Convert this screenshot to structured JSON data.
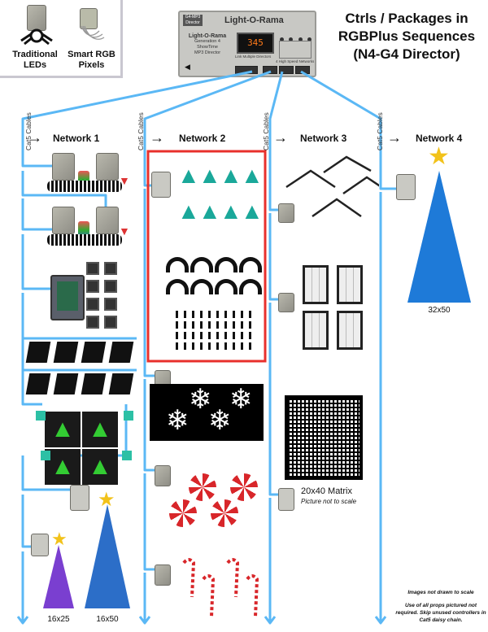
{
  "title": {
    "line1": "Ctrls / Packages in",
    "line2": "RGBPlus Sequences",
    "line3": "(N4-G4 Director)"
  },
  "legend": {
    "items": [
      {
        "label_line1": "Traditional",
        "label_line2": "LEDs",
        "icon": "traditional-controller-icon"
      },
      {
        "label_line1": "Smart RGB",
        "label_line2": "Pixels",
        "icon": "pixel-controller-icon"
      }
    ]
  },
  "director": {
    "badge_line1": "G4-MP3",
    "badge_line2": "Director",
    "brand": "Light-O-Rama",
    "model_line1": "Light-O-Rama",
    "model_line2": "Generation 4",
    "model_line3": "ShowTime",
    "model_line4": "MP3 Director",
    "display_value": "345",
    "link_label": "Link Multiple Directors",
    "networks_label": "4 High Speed Networks"
  },
  "cable_label": "Cat5 Cables",
  "networks": [
    {
      "name": "Network 1",
      "props": [
        {
          "type": "traditional-controller-pair",
          "items": [
            "Mini light strings",
            "C9 bulbs"
          ]
        },
        {
          "type": "traditional-controller-pair",
          "items": [
            "Mini light strings",
            "C9 bulbs"
          ]
        },
        {
          "type": "floodlight-controller",
          "items": [
            "8 small floodlights"
          ]
        },
        {
          "type": "floodlight-row",
          "items": [
            "4 floodlights"
          ]
        },
        {
          "type": "floodlight-row",
          "items": [
            "4 floodlights"
          ]
        },
        {
          "type": "singing-trees",
          "items": [
            "4 singing face trees"
          ]
        },
        {
          "type": "pixel-tree",
          "label": "16x25"
        },
        {
          "type": "pixel-tree",
          "label": "16x50"
        }
      ]
    },
    {
      "name": "Network 2",
      "props": [
        {
          "type": "mini-trees",
          "items": [
            "8 mini trees",
            "8 arches",
            "40 mini stakes"
          ],
          "highlighted": true
        },
        {
          "type": "snowflakes",
          "items": [
            "4 snowflakes"
          ]
        },
        {
          "type": "peppermints",
          "items": [
            "4 peppermint wheels"
          ]
        },
        {
          "type": "candy-canes",
          "items": [
            "4 candy canes"
          ]
        }
      ]
    },
    {
      "name": "Network 3",
      "props": [
        {
          "type": "roofline-peaks",
          "items": [
            "5 roof peaks"
          ]
        },
        {
          "type": "windows",
          "items": [
            "4 windows"
          ]
        },
        {
          "type": "matrix",
          "label": "20x40 Matrix",
          "sublabel": "Picture not to scale"
        }
      ]
    },
    {
      "name": "Network 4",
      "props": [
        {
          "type": "pixel-tree",
          "label": "32x50"
        }
      ]
    }
  ],
  "notes": {
    "line1": "Images not drawn to scale",
    "line2": "Use of all props pictured not required. Skip unused controllers in Cat5 daisy chain."
  },
  "colors": {
    "cable": "#5bb8f5",
    "highlight": "#e8302c",
    "controller": "#a3a29a"
  }
}
